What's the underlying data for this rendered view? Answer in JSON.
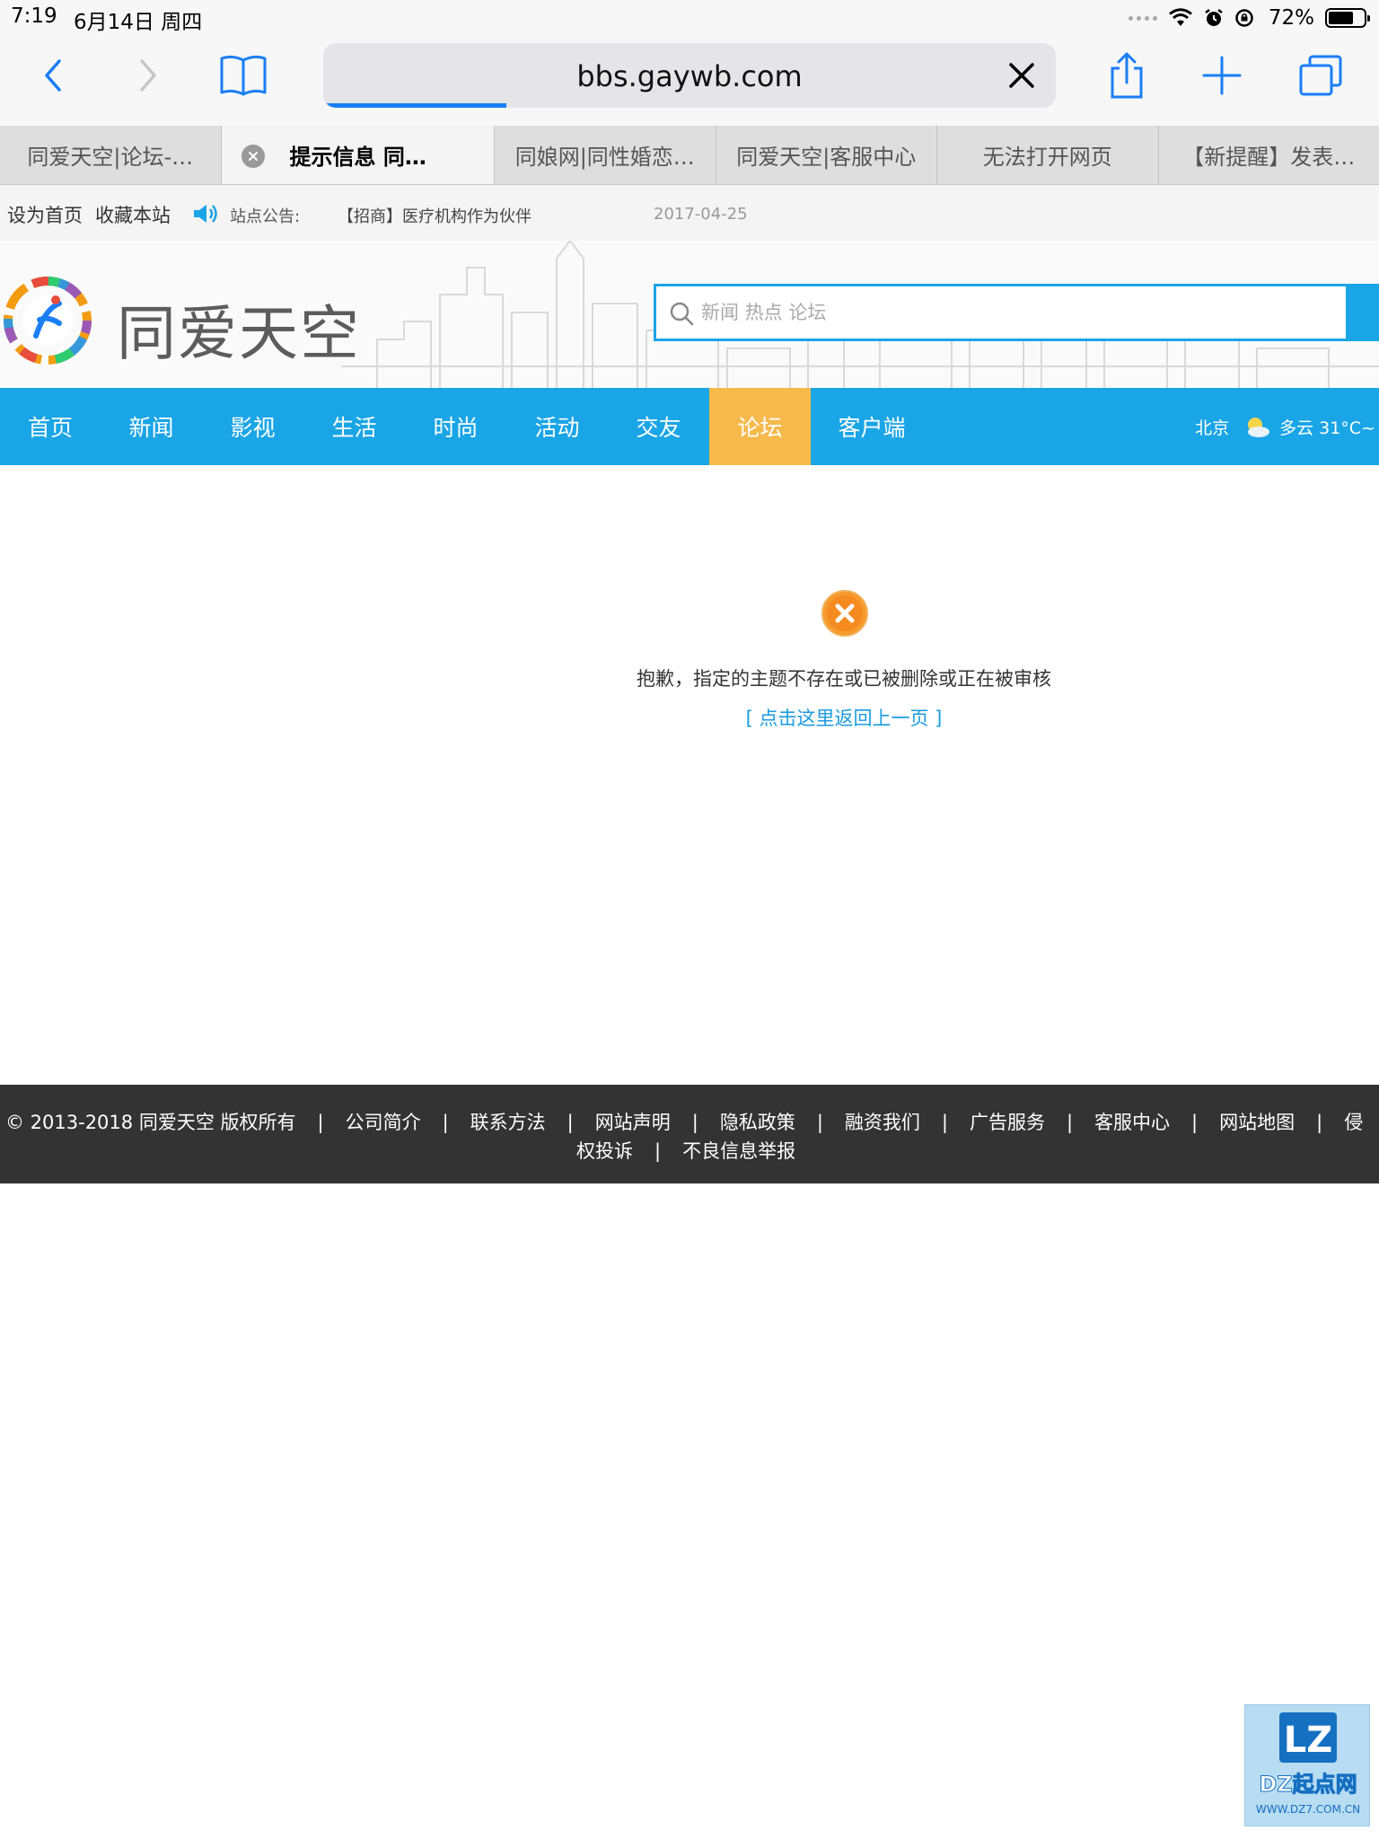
{
  "status_bar": {
    "time": "7:19",
    "date": "6月14日 周四",
    "battery_percent": "72%",
    "battery_level": 0.72
  },
  "browser": {
    "url": "bbs.gaywb.com",
    "load_progress": 0.25,
    "accent_color": "#1a7ef5",
    "tabs": [
      {
        "label": "同爱天空|论坛-…",
        "active": false
      },
      {
        "label": "提示信息 同…",
        "active": true
      },
      {
        "label": "同娘网|同性婚恋…",
        "active": false
      },
      {
        "label": "同爱天空|客服中心",
        "active": false
      },
      {
        "label": "无法打开网页",
        "active": false
      },
      {
        "label": "【新提醒】发表…",
        "active": false
      }
    ]
  },
  "topbar": {
    "set_home": "设为首页",
    "bookmark": "收藏本站",
    "notice_label": "站点公告:",
    "notice_text": "【招商】医疗机构作为伙伴",
    "notice_date": "2017-04-25"
  },
  "header": {
    "logo_text": "同爱天空",
    "search_placeholder": "新闻 热点 论坛",
    "brand_color": "#1aa5e6"
  },
  "nav": {
    "items": [
      "首页",
      "新闻",
      "影视",
      "生活",
      "时尚",
      "活动",
      "交友",
      "论坛",
      "客户端"
    ],
    "active_index": 7,
    "active_color": "#f7b94b",
    "weather_city": "北京",
    "weather_text": "多云 31°C~"
  },
  "message": {
    "text": "抱歉，指定的主题不存在或已被删除或正在被审核",
    "back_link": "[ 点击这里返回上一页 ]"
  },
  "footer": {
    "copyright": "© 2013-2018 同爱天空 版权所有",
    "links": [
      "公司简介",
      "联系方法",
      "网站声明",
      "隐私政策",
      "融资我们",
      "广告服务",
      "客服中心",
      "网站地图"
    ],
    "link_last_part1": "侵",
    "link_last_part2": "权投诉",
    "link_report": "不良信息举报",
    "separator": "|"
  },
  "watermark": {
    "badge": "LZ",
    "name": "DZ起点网",
    "url": "WWW.DZ7.COM.CN"
  }
}
